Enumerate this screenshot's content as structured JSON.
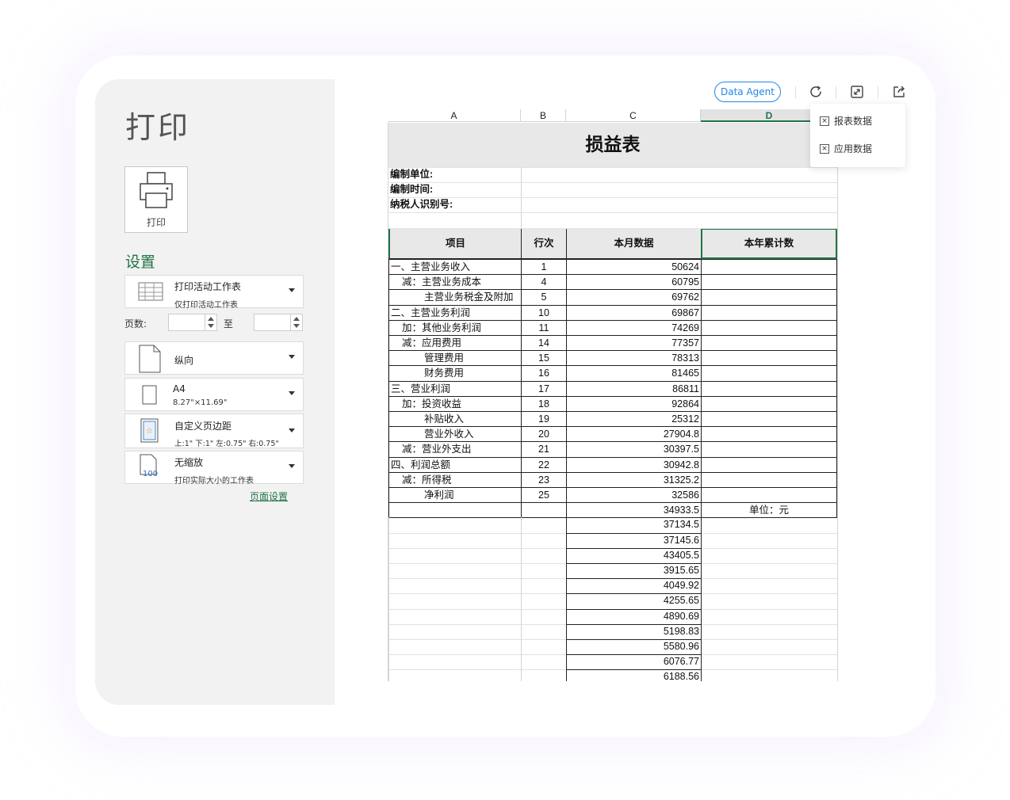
{
  "left_panel": {
    "title": "打印",
    "print_button_label": "打印",
    "settings_title": "设置",
    "print_range": {
      "title": "打印活动工作表",
      "subtitle": "仅打印活动工作表"
    },
    "pages": {
      "label": "页数:",
      "from_value": "",
      "to_label": "至",
      "to_value": ""
    },
    "orientation": {
      "title": "纵向"
    },
    "paper": {
      "title": "A4",
      "subtitle": "8.27\"×11.69\""
    },
    "margins": {
      "title": "自定义页边距",
      "subtitle": "上:1\" 下:1\" 左:0.75\" 右:0.75\""
    },
    "scaling": {
      "title": "无缩放",
      "subtitle": "打印实际大小的工作表",
      "icon_text": "100"
    },
    "page_setup_link": "页面设置"
  },
  "toolbar": {
    "agent_button": "Data Agent",
    "icons": [
      "refresh-icon",
      "expand-icon",
      "share-icon"
    ]
  },
  "export_menu": {
    "items": [
      "报表数据",
      "应用数据"
    ]
  },
  "sheet": {
    "columns": [
      "A",
      "B",
      "C",
      "D"
    ],
    "selected_column": "D",
    "title": "损益表",
    "meta": [
      "编制单位:",
      "编制时间:",
      "纳税人识别号:"
    ],
    "header": [
      "项目",
      "行次",
      "本月数据",
      "本年累计数"
    ],
    "rows": [
      {
        "item": "一、主营业务收入",
        "indent": 0,
        "line": "1",
        "month": "50624"
      },
      {
        "item": "减：主营业务成本",
        "indent": 1,
        "line": "4",
        "month": "60795"
      },
      {
        "item": "主营业务税金及附加",
        "indent": 2,
        "line": "5",
        "month": "69762"
      },
      {
        "item": "二、主营业务利润",
        "indent": 0,
        "line": "10",
        "month": "69867"
      },
      {
        "item": "加：其他业务利润",
        "indent": 1,
        "line": "11",
        "month": "74269"
      },
      {
        "item": "减：应用费用",
        "indent": 1,
        "line": "14",
        "month": "77357"
      },
      {
        "item": "管理费用",
        "indent": 2,
        "line": "15",
        "month": "78313"
      },
      {
        "item": "财务费用",
        "indent": 2,
        "line": "16",
        "month": "81465"
      },
      {
        "item": "三、营业利润",
        "indent": 0,
        "line": "17",
        "month": "86811"
      },
      {
        "item": "加：投资收益",
        "indent": 1,
        "line": "18",
        "month": "92864"
      },
      {
        "item": "补贴收入",
        "indent": 2,
        "line": "19",
        "month": "25312"
      },
      {
        "item": "营业外收入",
        "indent": 2,
        "line": "20",
        "month": "27904.8"
      },
      {
        "item": "减：营业外支出",
        "indent": 1,
        "line": "21",
        "month": "30397.5"
      },
      {
        "item": "四、利润总额",
        "indent": 0,
        "line": "22",
        "month": "30942.8"
      },
      {
        "item": "减：所得税",
        "indent": 1,
        "line": "23",
        "month": "31325.2"
      },
      {
        "item": "净利润",
        "indent": 2,
        "line": "25",
        "month": "32586"
      }
    ],
    "unit_row": {
      "month": "34933.5",
      "ytd": "单位：元"
    },
    "extra_values": [
      "37134.5",
      "37145.6",
      "43405.5",
      "3915.65",
      "4049.92",
      "4255.65",
      "4890.69",
      "5198.83",
      "5580.96",
      "6076.77",
      "6188.56"
    ]
  },
  "colors": {
    "accent_green": "#217346",
    "agent_blue": "#1e88e5",
    "panel_bg": "#f2f2f2",
    "header_fill": "#e8e8e8"
  }
}
